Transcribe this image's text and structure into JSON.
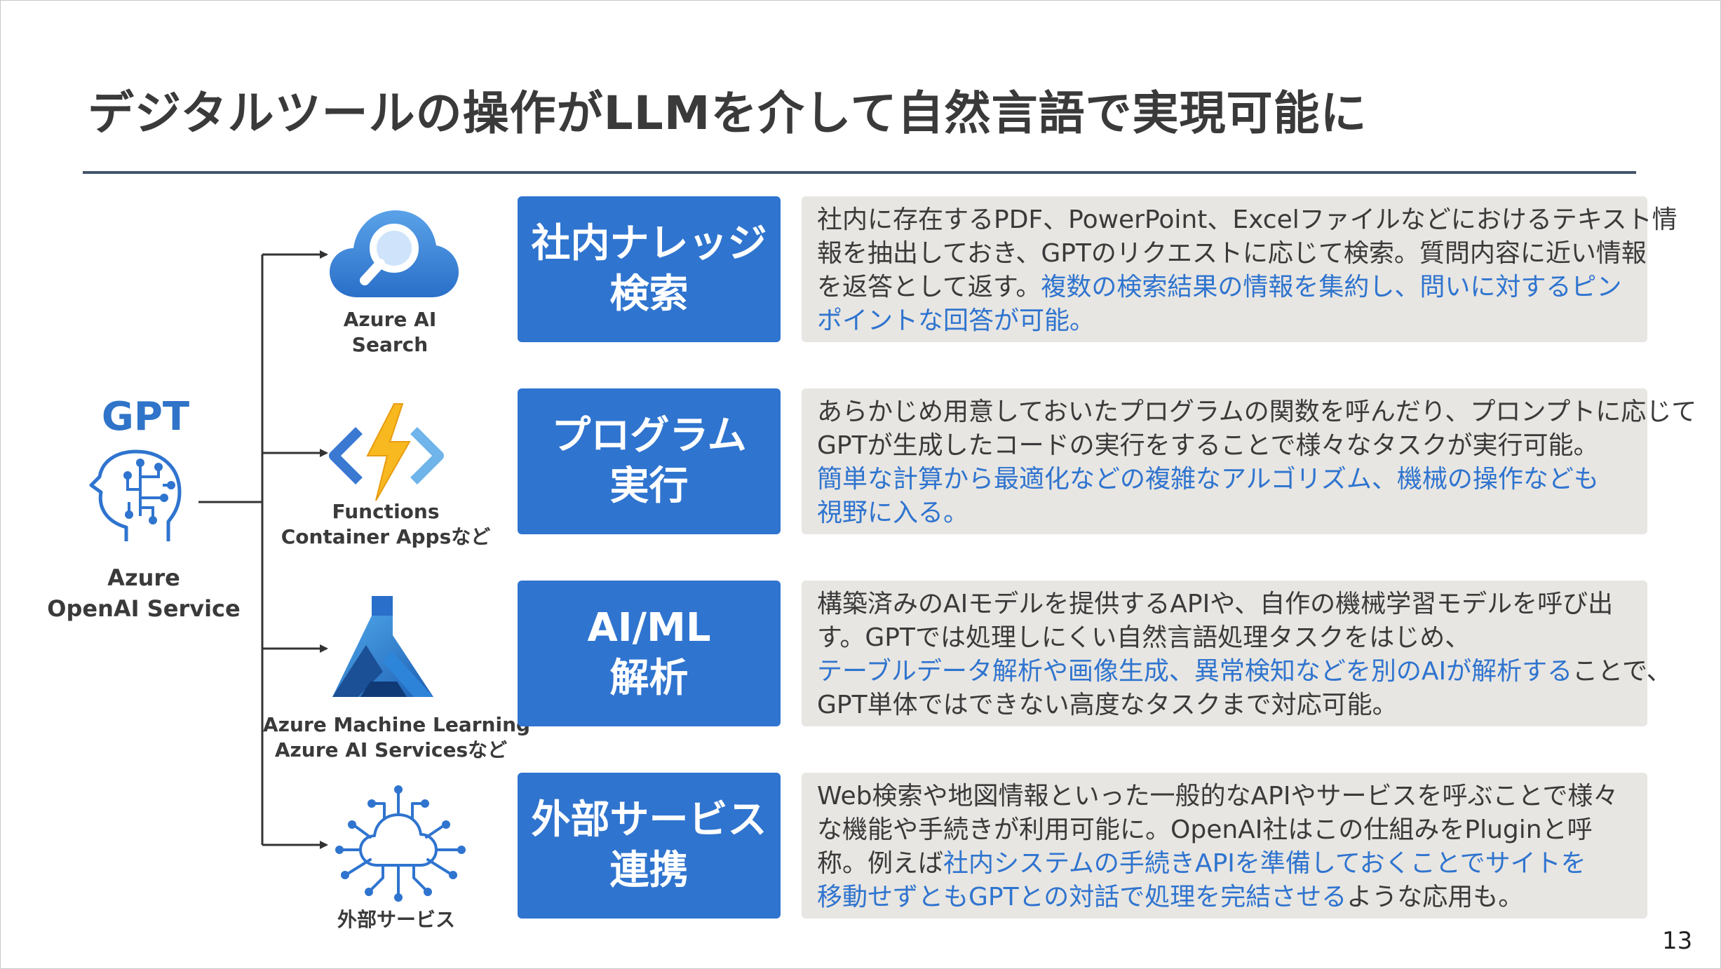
{
  "slide": {
    "title": "デジタルツールの操作がLLMを介して自然言語で実現可能に",
    "page_number": "13"
  },
  "gpt": {
    "label": "GPT",
    "service_line1": "Azure",
    "service_line2": "OpenAI Service",
    "icon": "head-circuit-icon"
  },
  "services": [
    {
      "line1": "Azure AI",
      "line2": "Search",
      "icon": "cloud-search-icon"
    },
    {
      "line1": "Functions",
      "line2": "Container Appsなど",
      "icon": "functions-lightning-icon"
    },
    {
      "line1": "Azure Machine Learning",
      "line2": "Azure AI Servicesなど",
      "icon": "ml-flask-icon"
    },
    {
      "line1": "外部サービス",
      "line2": "",
      "icon": "cloud-network-icon"
    }
  ],
  "capabilities": [
    {
      "title_line1": "社内ナレッジ",
      "title_line2": "検索",
      "desc": [
        [
          {
            "t": "社内に存在するPDF、PowerPoint、Excelファイルなどにおけるテキスト情",
            "h": false
          }
        ],
        [
          {
            "t": "報を抽出しておき、GPTのリクエストに応じて検索。質問内容に近い情報",
            "h": false
          }
        ],
        [
          {
            "t": "を返答として返す。",
            "h": false
          },
          {
            "t": "複数の検索結果の情報を集約し、問いに対するピン",
            "h": true
          }
        ],
        [
          {
            "t": "ポイントな回答が可能。",
            "h": true
          }
        ]
      ]
    },
    {
      "title_line1": "プログラム",
      "title_line2": "実行",
      "desc": [
        [
          {
            "t": "あらかじめ用意しておいたプログラムの関数を呼んだり、プロンプトに応じて",
            "h": false
          }
        ],
        [
          {
            "t": "GPTが生成したコードの実行をすることで様々なタスクが実行可能。",
            "h": false
          }
        ],
        [
          {
            "t": "簡単な計算から最適化などの複雑なアルゴリズム、機械の操作なども",
            "h": true
          }
        ],
        [
          {
            "t": "視野に入る。",
            "h": true
          }
        ]
      ]
    },
    {
      "title_line1": "AI/ML",
      "title_line2": "解析",
      "desc": [
        [
          {
            "t": "構築済みのAIモデルを提供するAPIや、自作の機械学習モデルを呼び出",
            "h": false
          }
        ],
        [
          {
            "t": "す。GPTでは処理しにくい自然言語処理タスクをはじめ、",
            "h": false
          }
        ],
        [
          {
            "t": "テーブルデータ解析や画像生成、異常検知などを別のAIが解析する",
            "h": true
          },
          {
            "t": "ことで、",
            "h": false
          }
        ],
        [
          {
            "t": "GPT単体ではできない高度なタスクまで対応可能。",
            "h": false
          }
        ]
      ]
    },
    {
      "title_line1": "外部サービス",
      "title_line2": "連携",
      "desc": [
        [
          {
            "t": "Web検索や地図情報といった一般的なAPIやサービスを呼ぶことで様々",
            "h": false
          }
        ],
        [
          {
            "t": "な機能や手続きが利用可能に。OpenAI社はこの仕組みをPluginと呼",
            "h": false
          }
        ],
        [
          {
            "t": "称。例えば",
            "h": false
          },
          {
            "t": "社内システムの手続きAPIを準備しておくことでサイトを",
            "h": true
          }
        ],
        [
          {
            "t": "移動せずともGPTとの対話で処理を完結させる",
            "h": true
          },
          {
            "t": "ような応用も。",
            "h": false
          }
        ]
      ]
    }
  ],
  "colors": {
    "accent_blue": "#2f74cf",
    "desc_bg": "#e8e6e2",
    "rule": "#44546a"
  }
}
